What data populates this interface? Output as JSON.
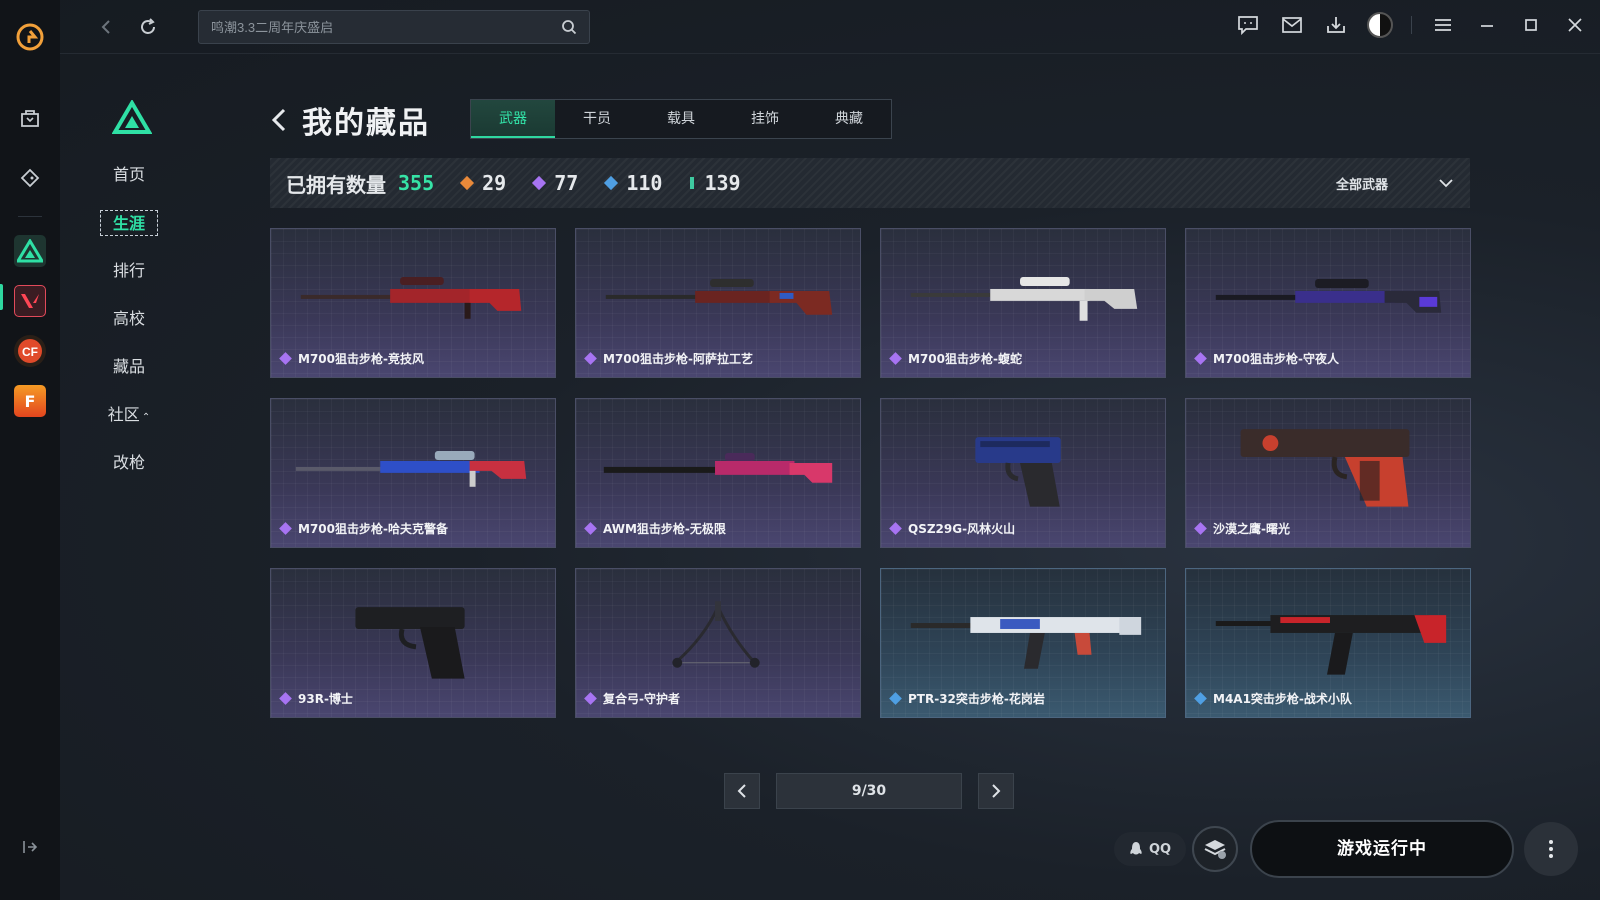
{
  "colors": {
    "accent": "#2fd8a0",
    "rarity_orange": "#e8893a",
    "rarity_purple": "#a774f2",
    "rarity_blue": "#4f9fe3",
    "rarity_green": "#3ec9a0"
  },
  "topbar": {
    "search_placeholder": "鸣潮3.3二周年庆盛启"
  },
  "subnav": {
    "items": [
      {
        "label": "首页"
      },
      {
        "label": "生涯"
      },
      {
        "label": "排行"
      },
      {
        "label": "高校"
      },
      {
        "label": "藏品"
      },
      {
        "label": "社区"
      },
      {
        "label": "改枪"
      }
    ]
  },
  "page": {
    "title": "我的藏品"
  },
  "tabs": [
    {
      "label": "武器"
    },
    {
      "label": "干员"
    },
    {
      "label": "载具"
    },
    {
      "label": "挂饰"
    },
    {
      "label": "典藏"
    }
  ],
  "stats": {
    "owned_label": "已拥有数量",
    "owned_count": "355",
    "orange_count": "29",
    "purple_count": "77",
    "blue_count": "110",
    "green_count": "139",
    "filter_label": "全部武器"
  },
  "items": [
    {
      "name": "M700狙击步枪-竞技风",
      "rarity": "purple"
    },
    {
      "name": "M700狙击步枪-阿萨拉工艺",
      "rarity": "purple"
    },
    {
      "name": "M700狙击步枪-蝮蛇",
      "rarity": "purple"
    },
    {
      "name": "M700狙击步枪-守夜人",
      "rarity": "purple"
    },
    {
      "name": "M700狙击步枪-哈夫克警备",
      "rarity": "purple"
    },
    {
      "name": "AWM狙击步枪-无极限",
      "rarity": "purple"
    },
    {
      "name": "QSZ29G-风林火山",
      "rarity": "purple"
    },
    {
      "name": "沙漠之鹰-曙光",
      "rarity": "purple"
    },
    {
      "name": "93R-博士",
      "rarity": "purple"
    },
    {
      "name": "复合弓-守护者",
      "rarity": "purple"
    },
    {
      "name": "PTR-32突击步枪-花岗岩",
      "rarity": "blue"
    },
    {
      "name": "M4A1突击步枪-战术小队",
      "rarity": "blue"
    }
  ],
  "pager": {
    "info": "9/30"
  },
  "bottom": {
    "qq_label": "QQ",
    "launch_label": "游戏运行中"
  }
}
